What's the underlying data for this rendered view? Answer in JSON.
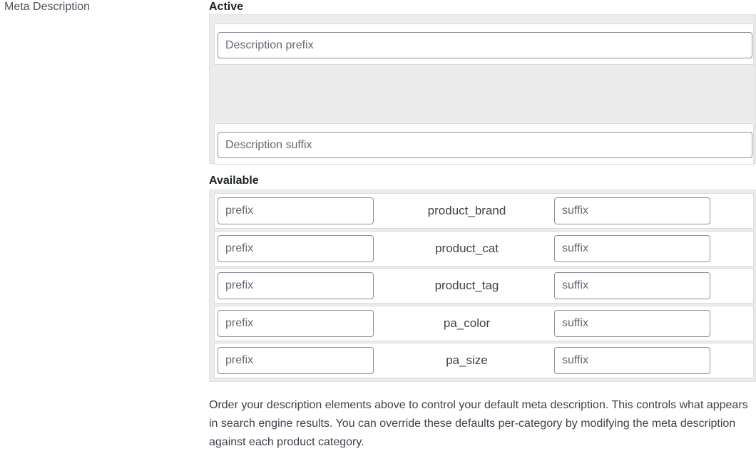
{
  "field_label": "Meta Description",
  "active": {
    "heading": "Active",
    "prefix_placeholder": "Description prefix",
    "suffix_placeholder": "Description suffix"
  },
  "available": {
    "heading": "Available",
    "rows": [
      {
        "prefix_placeholder": "prefix",
        "name": "product_brand",
        "suffix_placeholder": "suffix"
      },
      {
        "prefix_placeholder": "prefix",
        "name": "product_cat",
        "suffix_placeholder": "suffix"
      },
      {
        "prefix_placeholder": "prefix",
        "name": "product_tag",
        "suffix_placeholder": "suffix"
      },
      {
        "prefix_placeholder": "prefix",
        "name": "pa_color",
        "suffix_placeholder": "suffix"
      },
      {
        "prefix_placeholder": "prefix",
        "name": "pa_size",
        "suffix_placeholder": "suffix"
      }
    ]
  },
  "help_text": "Order your description elements above to control your default meta description. This controls what appears in search engine results. You can override these defaults per-category by modifying the meta description against each product category."
}
